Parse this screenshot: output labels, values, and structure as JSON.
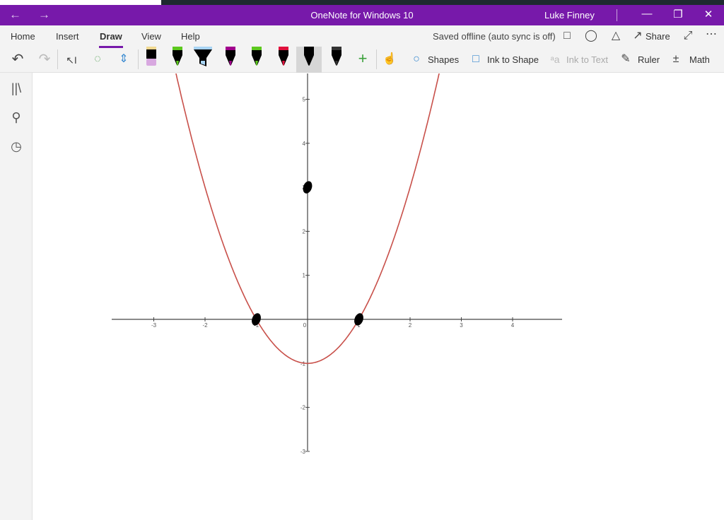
{
  "window": {
    "title": "OneNote for Windows 10",
    "user": "Luke Finney",
    "back_icon": "arrow-left",
    "forward_icon": "arrow-right"
  },
  "ribbon": {
    "tabs": [
      {
        "label": "Home"
      },
      {
        "label": "Insert"
      },
      {
        "label": "Draw",
        "active": true
      },
      {
        "label": "View"
      },
      {
        "label": "Help"
      }
    ],
    "status": "Saved offline (auto sync is off)",
    "share_label": "Share",
    "tools": {
      "shapes": "Shapes",
      "ink_to_shape": "Ink to Shape",
      "ink_to_text": "Ink to Text",
      "ruler": "Ruler",
      "math": "Math"
    },
    "pens": [
      {
        "type": "eraser",
        "color": "#d8a8e0"
      },
      {
        "type": "pencil",
        "color": "#5cc81e"
      },
      {
        "type": "highlighter",
        "color": "#a8d4f4"
      },
      {
        "type": "pen",
        "color": "#a0008c"
      },
      {
        "type": "pen",
        "color": "#5cc81e"
      },
      {
        "type": "pen",
        "color": "#e0103c"
      },
      {
        "type": "pen",
        "color": "#000000",
        "selected": true
      },
      {
        "type": "pen",
        "color": "#333333"
      }
    ],
    "accent": "#7719aa"
  },
  "graph": {
    "function": "y = x^2 - 1",
    "curve_color": "#c8504a",
    "x_ticks": [
      "-3",
      "-2",
      "-1",
      "0",
      "1",
      "2",
      "3",
      "4"
    ],
    "y_ticks": [
      "-3",
      "-2",
      "-1",
      "1",
      "2",
      "3",
      "4",
      "5"
    ],
    "ink_points": [
      {
        "x": -1,
        "y": 0
      },
      {
        "x": 1,
        "y": 0
      },
      {
        "x": 0,
        "y": 3
      }
    ]
  }
}
